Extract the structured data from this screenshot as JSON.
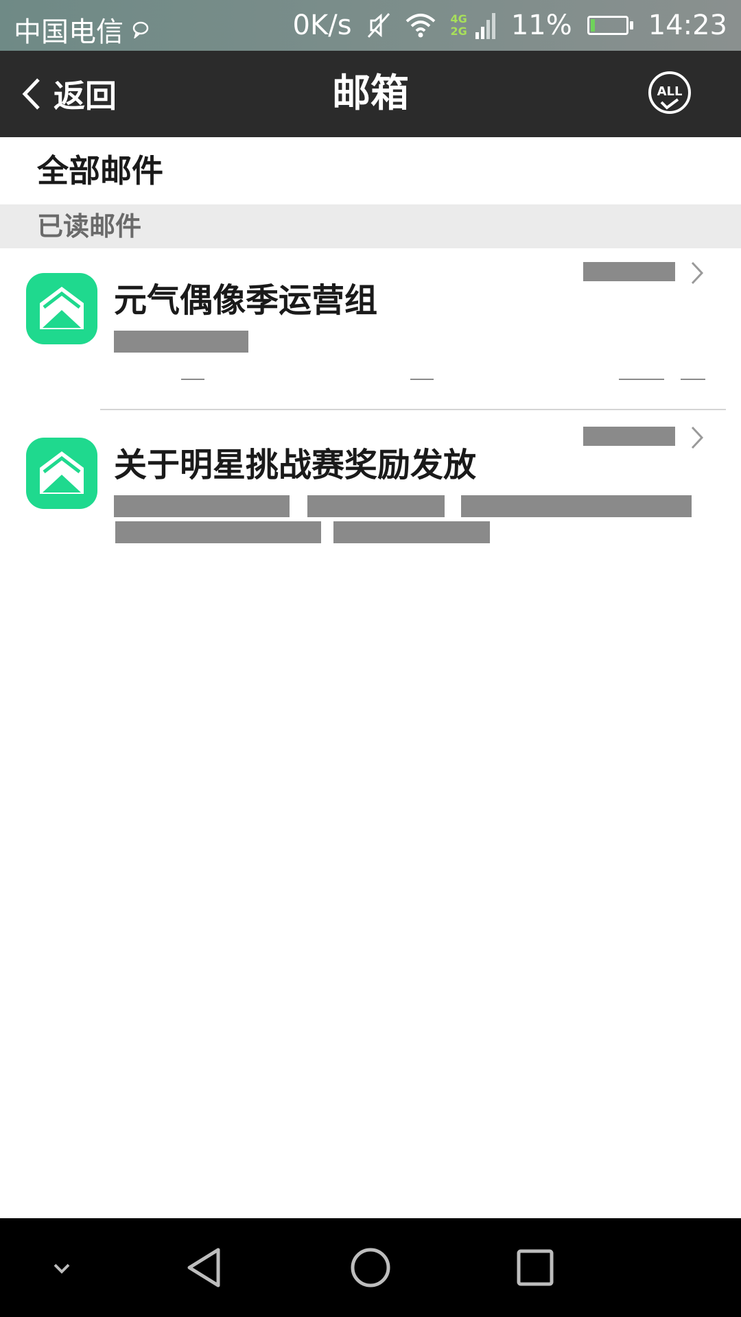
{
  "status_bar": {
    "carrier": "中国电信",
    "speed": "0K/s",
    "network_top": "4G",
    "network_bottom": "2G",
    "battery": "11%",
    "battery_level": 0.11,
    "time": "14:23"
  },
  "header": {
    "back_label": "返回",
    "title": "邮箱",
    "all_label": "ALL"
  },
  "sections": {
    "all_mail": "全部邮件",
    "read_mail": "已读邮件"
  },
  "mails": [
    {
      "title": "元气偶像季运营组",
      "icon": "mail-icon"
    },
    {
      "title": "关于明星挑战赛奖励发放",
      "icon": "mail-icon"
    }
  ],
  "colors": {
    "header_bg": "#2b2b2b",
    "accent": "#1fd98e",
    "section_bg": "#ebebeb",
    "redaction": "#8a8a8a"
  }
}
